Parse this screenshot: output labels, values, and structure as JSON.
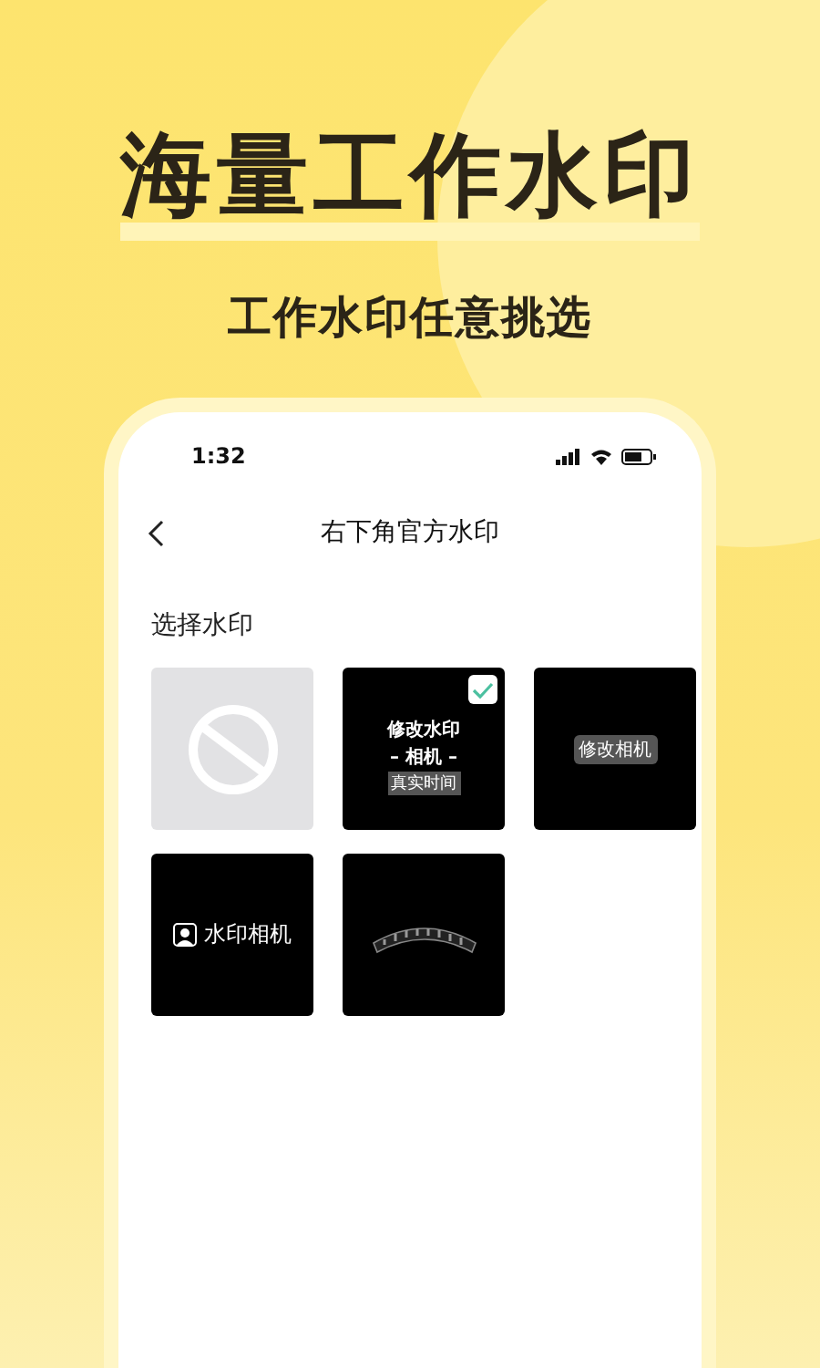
{
  "headline": "海量工作水印",
  "subtitle": "工作水印任意挑选",
  "phone": {
    "status_bar": {
      "time": "1:32"
    },
    "nav": {
      "title": "右下角官方水印"
    },
    "section_label": "选择水印",
    "watermarks": [
      {
        "kind": "none",
        "selected": false
      },
      {
        "kind": "stacked",
        "selected": true,
        "lines": [
          "修改水印",
          "– 相机 –",
          "真实时间"
        ]
      },
      {
        "kind": "badge",
        "selected": false,
        "lines": [
          "修改相机"
        ]
      },
      {
        "kind": "icon-label",
        "selected": false,
        "lines": [
          "水印相机"
        ]
      },
      {
        "kind": "arched",
        "selected": false
      }
    ]
  }
}
